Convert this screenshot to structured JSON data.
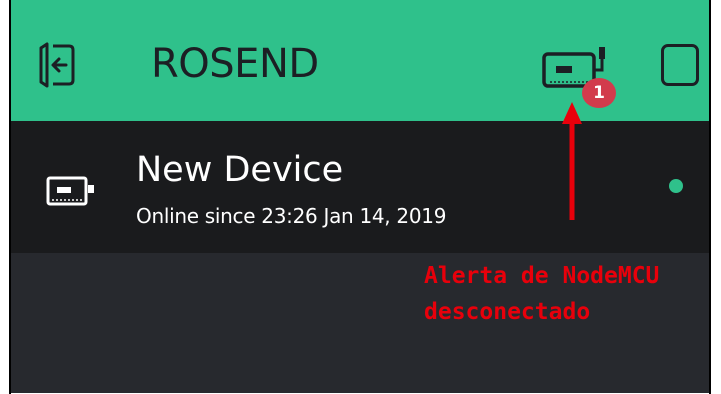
{
  "header": {
    "title": "ROSEND",
    "background": "#2fc18b",
    "icon_color": "#1c1f24",
    "back_icon": "back-icon",
    "devices_icon": "device-board-icon",
    "square_icon": "square-outline-icon",
    "notification_count": "1",
    "badge_color": "#d23b4c"
  },
  "device": {
    "name": "New Device",
    "status": "Online since 23:26 Jan 14, 2019",
    "icon": "device-board-icon",
    "online_color": "#2fc18b",
    "row_background": "#1a1b1d"
  },
  "annotation": {
    "line1": "Alerta de NodeMCU",
    "line2": "desconectado",
    "color": "#e8000b",
    "arrow_icon": "arrow-up-icon"
  },
  "body_background": "#27292e"
}
